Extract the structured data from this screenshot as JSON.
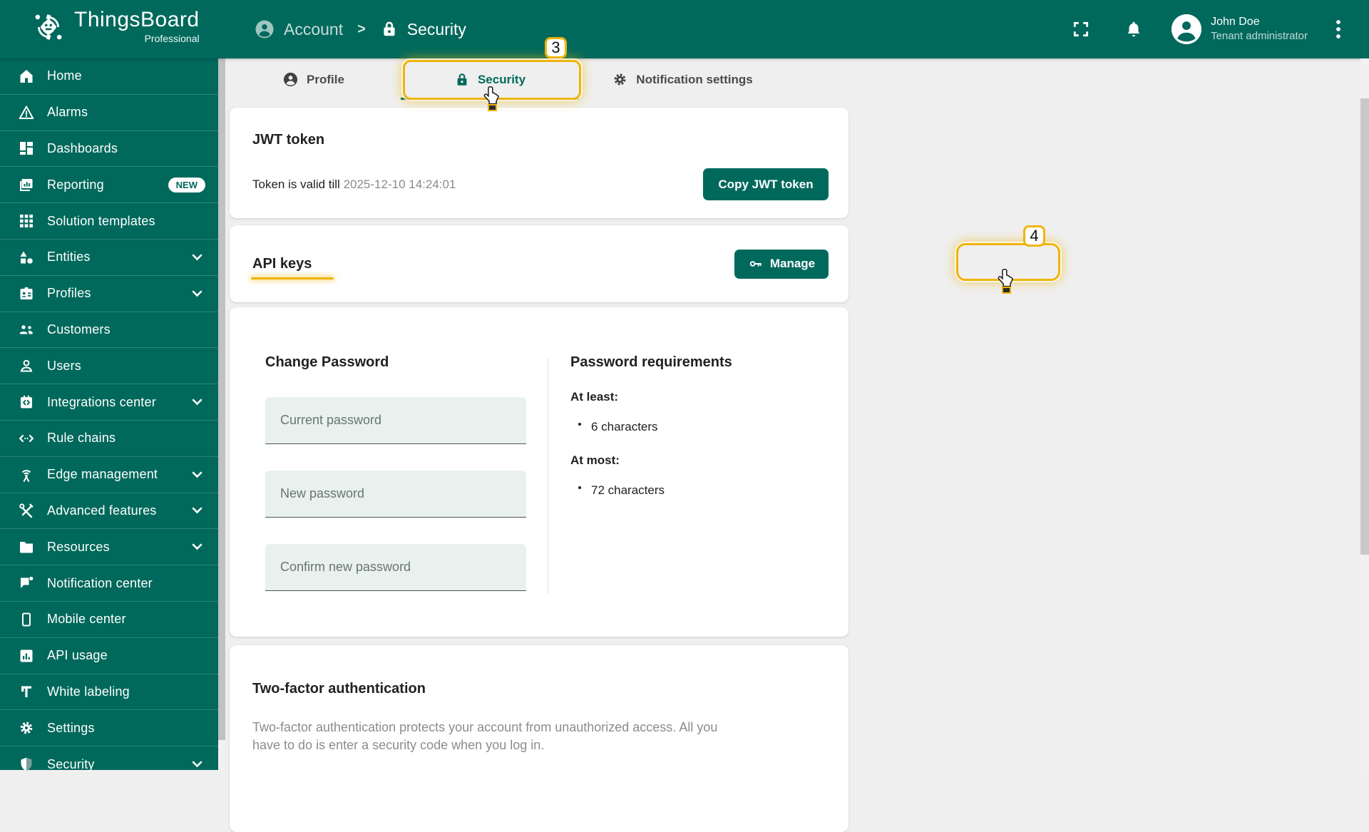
{
  "topbar": {
    "logo_title": "ThingsBoard",
    "logo_subtitle": "Professional",
    "breadcrumb": {
      "parent": "Account",
      "separator": ">",
      "current": "Security"
    },
    "user": {
      "name": "John Doe",
      "role": "Tenant administrator"
    },
    "icons": [
      "fullscreen-icon",
      "notifications-bell-icon",
      "avatar",
      "kebab-menu-icon"
    ]
  },
  "sidebar": {
    "items": [
      {
        "label": "Home",
        "icon": "home-icon"
      },
      {
        "label": "Alarms",
        "icon": "alarm-warning-icon"
      },
      {
        "label": "Dashboards",
        "icon": "dashboards-icon"
      },
      {
        "label": "Reporting",
        "icon": "reporting-icon",
        "badge": "NEW"
      },
      {
        "label": "Solution templates",
        "icon": "solution-templates-icon"
      },
      {
        "label": "Entities",
        "icon": "entities-icon",
        "expandable": true
      },
      {
        "label": "Profiles",
        "icon": "profiles-icon",
        "expandable": true
      },
      {
        "label": "Customers",
        "icon": "customers-icon"
      },
      {
        "label": "Users",
        "icon": "users-icon"
      },
      {
        "label": "Integrations center",
        "icon": "integrations-icon",
        "expandable": true
      },
      {
        "label": "Rule chains",
        "icon": "rule-chains-icon"
      },
      {
        "label": "Edge management",
        "icon": "edge-management-icon",
        "expandable": true
      },
      {
        "label": "Advanced features",
        "icon": "advanced-features-icon",
        "expandable": true
      },
      {
        "label": "Resources",
        "icon": "resources-icon",
        "expandable": true
      },
      {
        "label": "Notification center",
        "icon": "notification-center-icon"
      },
      {
        "label": "Mobile center",
        "icon": "mobile-center-icon"
      },
      {
        "label": "API usage",
        "icon": "api-usage-icon"
      },
      {
        "label": "White labeling",
        "icon": "white-labeling-icon"
      },
      {
        "label": "Settings",
        "icon": "settings-gear-icon"
      },
      {
        "label": "Security",
        "icon": "security-shield-icon",
        "expandable": true
      }
    ]
  },
  "tabs": [
    {
      "label": "Profile",
      "icon": "person-icon",
      "active": false
    },
    {
      "label": "Security",
      "icon": "lock-icon",
      "active": true
    },
    {
      "label": "Notification settings",
      "icon": "gear-icon",
      "active": false
    }
  ],
  "jwt_card": {
    "title": "JWT token",
    "valid_label": "Token is valid till",
    "valid_until": "2025-12-10 14:24:01",
    "copy_button": "Copy JWT token"
  },
  "api_keys_card": {
    "title": "API keys",
    "manage_button": "Manage",
    "manage_icon": "key-icon"
  },
  "password_card": {
    "title": "Change Password",
    "fields": [
      {
        "placeholder": "Current password",
        "value": ""
      },
      {
        "placeholder": "New password",
        "value": ""
      },
      {
        "placeholder": "Confirm new password",
        "value": ""
      }
    ],
    "requirements": {
      "title": "Password requirements",
      "at_least_label": "At least:",
      "at_least_items": [
        "6 characters"
      ],
      "at_most_label": "At most:",
      "at_most_items": [
        "72 characters"
      ]
    }
  },
  "twofa_card": {
    "title": "Two-factor authentication",
    "description": "Two-factor authentication protects your account from unauthorized access. All you have to do is enter a security code when you log in."
  },
  "annotations": {
    "tab_step_badge": "3",
    "manage_step_badge": "4"
  },
  "colors": {
    "primary_green": "#00695c",
    "annotation_yellow": "#f0b40a",
    "page_background": "#efefef",
    "card_background": "#ffffff"
  }
}
